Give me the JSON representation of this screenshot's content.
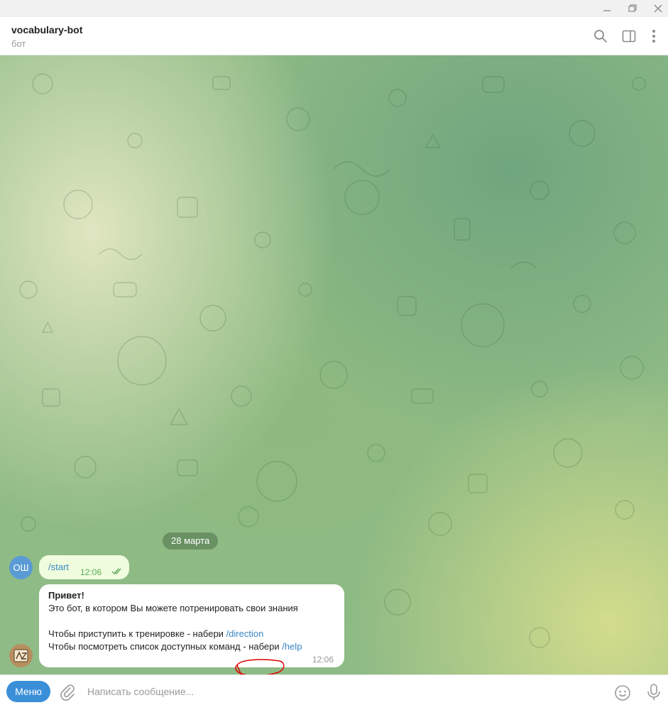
{
  "window": {
    "minimize_icon": "minimize-icon",
    "restore_icon": "restore-icon",
    "close_icon": "close-icon"
  },
  "header": {
    "title": "vocabulary-bot",
    "subtitle": "бот",
    "icons": [
      "search-icon",
      "sidebar-toggle-icon",
      "more-vertical-icon"
    ]
  },
  "chat": {
    "date_separator": "28 марта",
    "messages": [
      {
        "direction": "outgoing",
        "avatar_initials": "ОШ",
        "text": "/start",
        "time": "12:06",
        "status": "read"
      },
      {
        "direction": "incoming",
        "lines": [
          "Привет!",
          "Это бот, в котором Вы можете потренировать свои знания",
          "Чтобы приступить к тренировке - набери ",
          "Чтобы посмотреть список доступных команд - набери "
        ],
        "links": [
          "/direction",
          "/help"
        ],
        "time": "12:06"
      }
    ]
  },
  "compose": {
    "menu_label": "Меню",
    "placeholder": "Написать сообщение...",
    "icons": [
      "attach-icon",
      "emoji-icon",
      "microphone-icon"
    ]
  },
  "colors": {
    "accent": "#3a8fd8",
    "link": "#3a84c4",
    "outgoing_bubble": "#effdde",
    "annotation": "#e00000"
  }
}
